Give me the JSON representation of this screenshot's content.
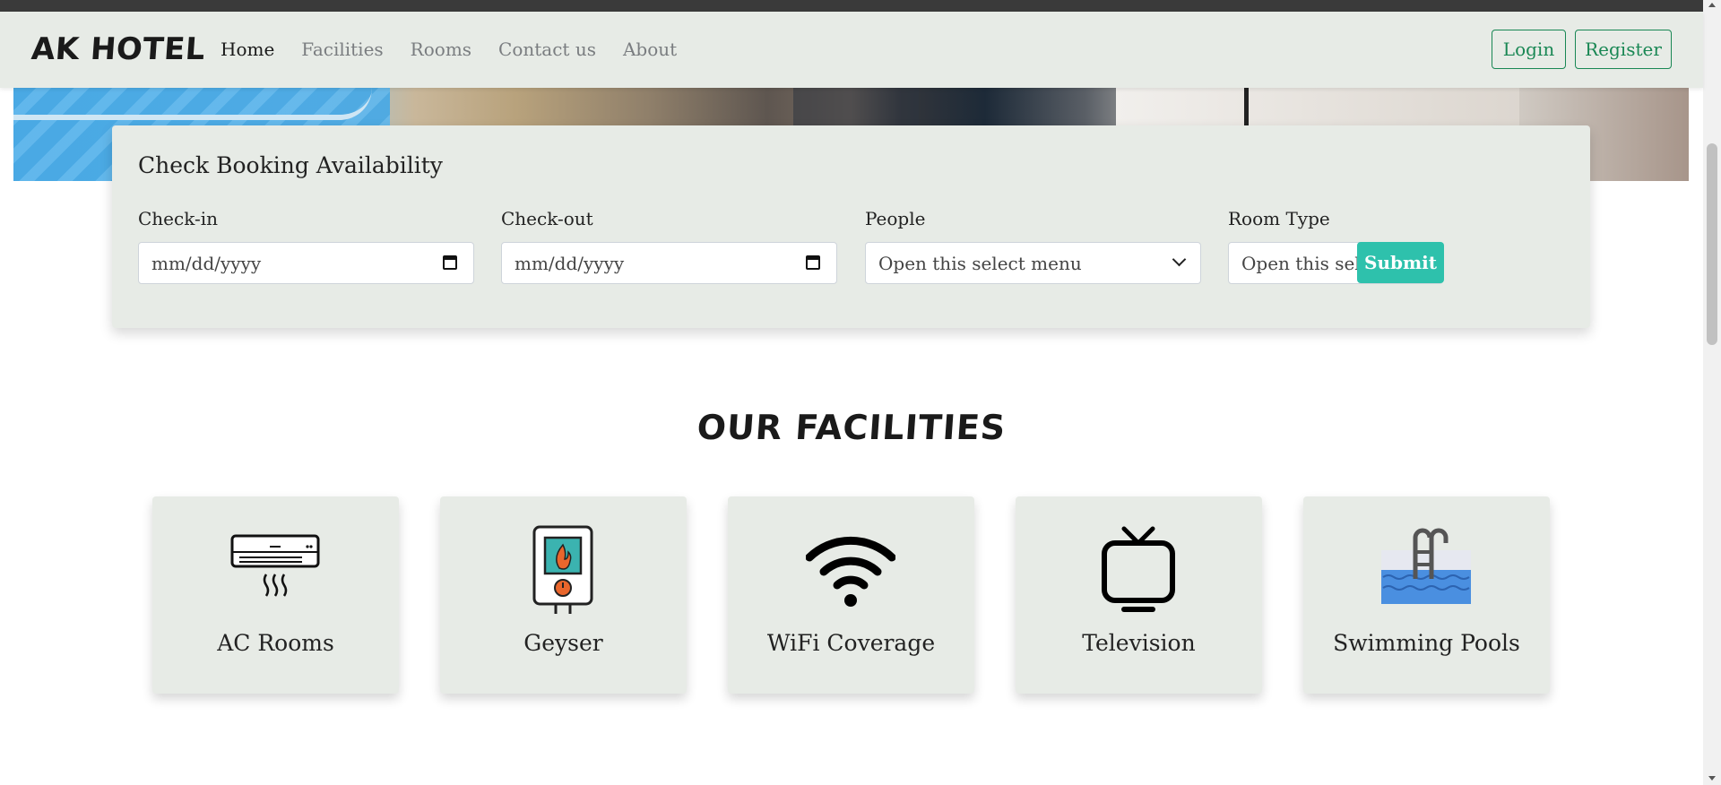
{
  "brand": "AK HOTEL",
  "nav": {
    "items": [
      {
        "label": "Home",
        "active": true
      },
      {
        "label": "Facilities",
        "active": false
      },
      {
        "label": "Rooms",
        "active": false
      },
      {
        "label": "Contact us",
        "active": false
      },
      {
        "label": "About",
        "active": false
      }
    ],
    "login_label": "Login",
    "register_label": "Register"
  },
  "booking": {
    "title": "Check Booking Availability",
    "checkin": {
      "label": "Check-in",
      "placeholder": "mm/dd/yyyy"
    },
    "checkout": {
      "label": "Check-out",
      "placeholder": "mm/dd/yyyy"
    },
    "people": {
      "label": "People",
      "selected": "Open this select menu"
    },
    "room_type": {
      "label": "Room Type",
      "selected": "Open this select menu"
    },
    "submit_label": "Submit"
  },
  "facilities": {
    "title": "OUR FACILITIES",
    "items": [
      {
        "label": "AC Rooms",
        "icon": "air-conditioner-icon"
      },
      {
        "label": "Geyser",
        "icon": "geyser-icon"
      },
      {
        "label": "WiFi Coverage",
        "icon": "wifi-icon"
      },
      {
        "label": "Television",
        "icon": "television-icon"
      },
      {
        "label": "Swimming Pools",
        "icon": "swimming-pool-icon"
      }
    ]
  },
  "colors": {
    "accent": "#2ec1ac",
    "outline_green": "#198754",
    "card_bg": "#e7ebe6",
    "topbar": "#3a3a3a"
  }
}
